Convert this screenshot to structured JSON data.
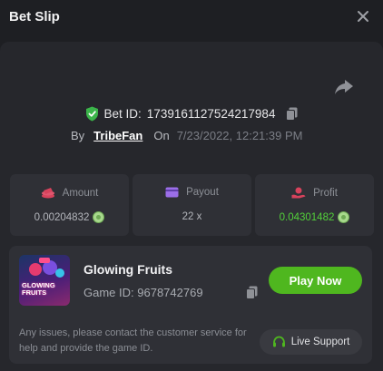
{
  "window": {
    "title": "Bet Slip",
    "close_icon": "close-icon"
  },
  "bet": {
    "id_label": "Bet ID:",
    "id_value": "1739161127524217984",
    "by_label": "By",
    "user": "TribeFan",
    "on_label": "On",
    "date": "7/23/2022, 12:21:39 PM"
  },
  "stats": [
    {
      "label": "Amount",
      "value": "0.00204832",
      "icon": "coins-icon"
    },
    {
      "label": "Payout",
      "value": "22 x",
      "icon": "wallet-icon"
    },
    {
      "label": "Profit",
      "value": "0.04301482",
      "icon": "profit-icon"
    }
  ],
  "game": {
    "name": "Glowing Fruits",
    "id_label": "Game ID:",
    "id_value": "9678742769",
    "thumb_text": "GLOWING FRUITS",
    "play_label": "Play Now"
  },
  "footer": {
    "notice": "Any issues, please contact the customer service for help and provide the game ID.",
    "support_label": "Live Support"
  },
  "colors": {
    "accent": "#4fb71f",
    "profit": "#53d13a",
    "shield": "#3bb54a",
    "stat_icon": "#d8425c"
  }
}
